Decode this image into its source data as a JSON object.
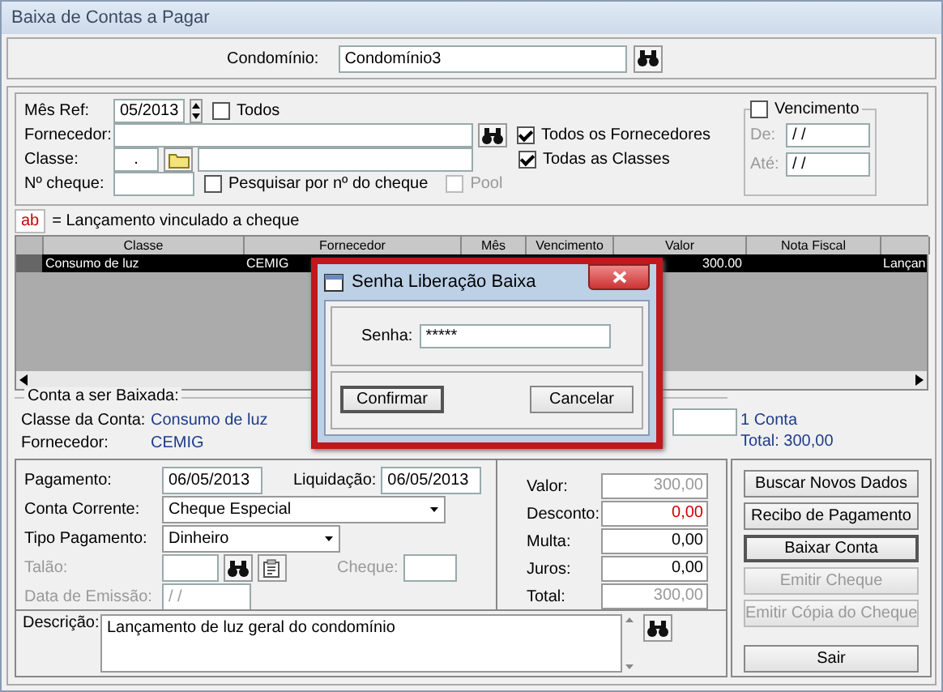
{
  "window": {
    "title": "Baixa de Contas a Pagar"
  },
  "condominio": {
    "label": "Condomínio:",
    "value": "Condomínio3"
  },
  "filters": {
    "mes_ref": {
      "label": "Mês Ref:",
      "value": "05/2013"
    },
    "todos": {
      "label": "Todos",
      "checked": false
    },
    "fornecedor": {
      "label": "Fornecedor:"
    },
    "todos_fornecedores": {
      "label": "Todos os Fornecedores",
      "checked": true
    },
    "classe": {
      "label": "Classe:",
      "value": "."
    },
    "todas_classes": {
      "label": "Todas as Classes",
      "checked": true
    },
    "cheque": {
      "label": "Nº cheque:"
    },
    "pesquisar": {
      "label": "Pesquisar por nº do cheque",
      "checked": false
    },
    "pool": {
      "label": "Pool",
      "checked": false,
      "disabled": true
    }
  },
  "vencimento": {
    "label": "Vencimento",
    "checked": false,
    "de": {
      "label": "De:",
      "value": "/ /"
    },
    "ate": {
      "label": "Até:",
      "value": "/ /"
    }
  },
  "legend": {
    "icon_text": "ab",
    "text": "= Lançamento vinculado a cheque"
  },
  "grid": {
    "columns": [
      "Classe",
      "Fornecedor",
      "Mês",
      "Vencimento",
      "Valor",
      "Nota Fiscal"
    ],
    "rows": [
      {
        "selected": true,
        "cells": [
          "Consumo de luz",
          "CEMIG",
          null,
          null,
          "300.00",
          null,
          "Lançan"
        ]
      }
    ]
  },
  "account": {
    "title": "Conta a ser Baixada:",
    "classe_label": "Classe da Conta:",
    "classe": "Consumo de luz",
    "fornecedor_label": "Fornecedor:",
    "fornecedor": "CEMIG",
    "count": "1 Conta",
    "total": "Total: 300,00"
  },
  "payment": {
    "pagamento": {
      "label": "Pagamento:",
      "value": "06/05/2013"
    },
    "liquidacao": {
      "label": "Liquidação:",
      "value": "06/05/2013"
    },
    "conta_corrente": {
      "label": "Conta Corrente:",
      "value": "Cheque Especial"
    },
    "tipo_pagamento": {
      "label": "Tipo Pagamento:",
      "value": "Dinheiro"
    },
    "talao": {
      "label": "Talão:",
      "disabled": true
    },
    "cheque": {
      "label": "Cheque:",
      "disabled": true
    },
    "data_emissao": {
      "label": "Data de Emissão:",
      "value": "/ /",
      "disabled": true
    }
  },
  "totals": [
    {
      "label": "Valor:",
      "value": "300,00",
      "kind": "readonly"
    },
    {
      "label": "Desconto:",
      "value": "0,00",
      "kind": "discount"
    },
    {
      "label": "Multa:",
      "value": "0,00",
      "kind": "input"
    },
    {
      "label": "Juros:",
      "value": "0,00",
      "kind": "input"
    },
    {
      "label": "Total:",
      "value": "300,00",
      "kind": "readonly"
    }
  ],
  "descricao": {
    "label": "Descrição:",
    "value": "Lançamento de luz geral do condomínio"
  },
  "buttons": [
    {
      "label": "Buscar Novos Dados",
      "disabled": false,
      "default": false
    },
    {
      "label": "Recibo de Pagamento",
      "disabled": false,
      "default": false
    },
    {
      "label": "Baixar Conta",
      "disabled": false,
      "default": true
    },
    {
      "label": "Emitir Cheque",
      "disabled": true,
      "default": false
    },
    {
      "label": "Emitir Cópia do Cheque",
      "disabled": true,
      "default": false
    },
    {
      "label": "Sair",
      "disabled": false,
      "default": false
    }
  ],
  "dialog": {
    "title": "Senha Liberação Baixa",
    "label": "Senha:",
    "value": "*****",
    "buttons": [
      {
        "label": "Confirmar",
        "default": true
      },
      {
        "label": "Cancelar",
        "default": false
      }
    ]
  }
}
